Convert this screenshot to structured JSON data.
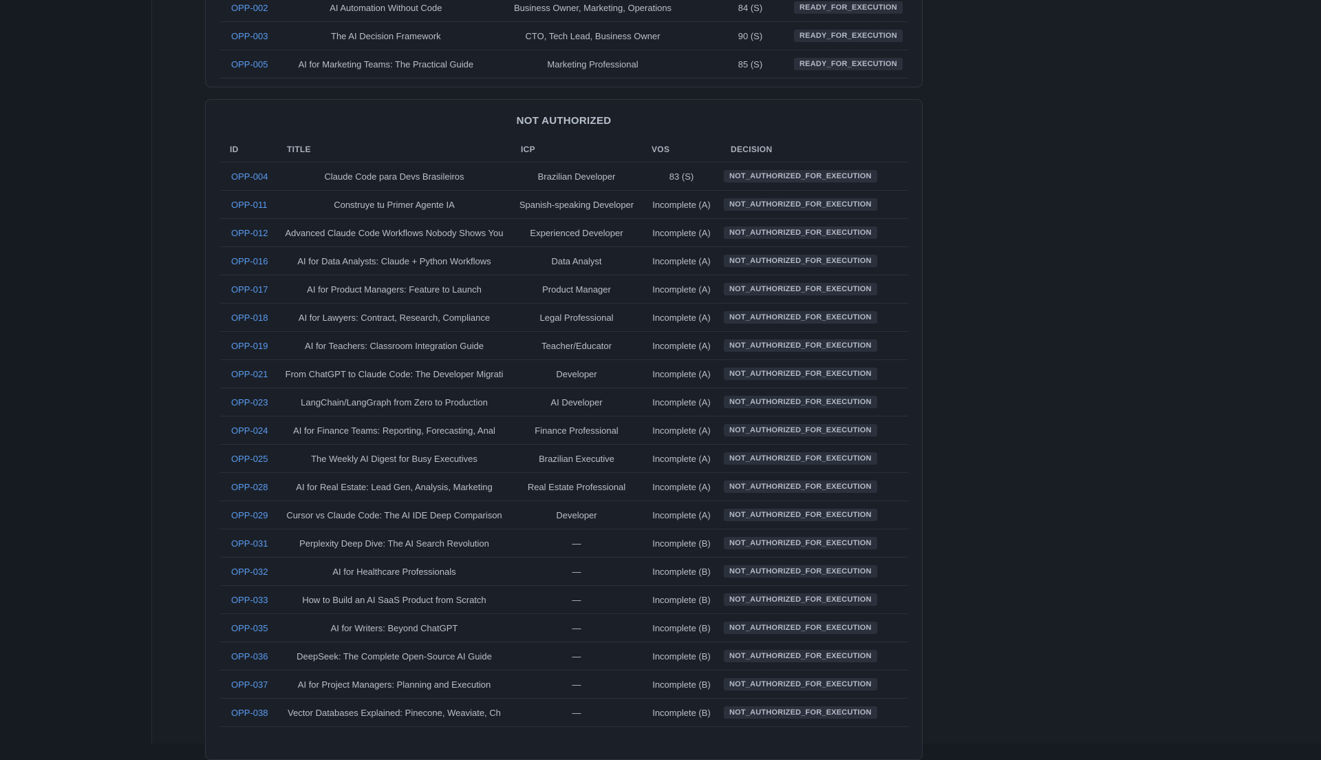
{
  "ready_table": {
    "rows": [
      {
        "id": "OPP-002",
        "title": "AI Automation Without Code",
        "icp": "Business Owner, Marketing, Operations",
        "vos": "84 (S)",
        "decision": "READY_FOR_EXECUTION"
      },
      {
        "id": "OPP-003",
        "title": "The AI Decision Framework",
        "icp": "CTO, Tech Lead, Business Owner",
        "vos": "90 (S)",
        "decision": "READY_FOR_EXECUTION"
      },
      {
        "id": "OPP-005",
        "title": "AI for Marketing Teams: The Practical Guide",
        "icp": "Marketing Professional",
        "vos": "85 (S)",
        "decision": "READY_FOR_EXECUTION"
      }
    ]
  },
  "not_authorized": {
    "title": "NOT AUTHORIZED",
    "headers": {
      "id": "ID",
      "title": "TITLE",
      "icp": "ICP",
      "vos": "VOS",
      "decision": "DECISION"
    },
    "rows": [
      {
        "id": "OPP-004",
        "title": "Claude Code para Devs Brasileiros",
        "icp": "Brazilian Developer",
        "vos": "83 (S)",
        "decision": "NOT_AUTHORIZED_FOR_EXECUTION"
      },
      {
        "id": "OPP-011",
        "title": "Construye tu Primer Agente IA",
        "icp": "Spanish-speaking Developer",
        "vos": "Incomplete (A)",
        "decision": "NOT_AUTHORIZED_FOR_EXECUTION"
      },
      {
        "id": "OPP-012",
        "title": "Advanced Claude Code Workflows Nobody Shows You",
        "icp": "Experienced Developer",
        "vos": "Incomplete (A)",
        "decision": "NOT_AUTHORIZED_FOR_EXECUTION"
      },
      {
        "id": "OPP-016",
        "title": "AI for Data Analysts: Claude + Python Workflows",
        "icp": "Data Analyst",
        "vos": "Incomplete (A)",
        "decision": "NOT_AUTHORIZED_FOR_EXECUTION"
      },
      {
        "id": "OPP-017",
        "title": "AI for Product Managers: Feature to Launch",
        "icp": "Product Manager",
        "vos": "Incomplete (A)",
        "decision": "NOT_AUTHORIZED_FOR_EXECUTION"
      },
      {
        "id": "OPP-018",
        "title": "AI for Lawyers: Contract, Research, Compliance",
        "icp": "Legal Professional",
        "vos": "Incomplete (A)",
        "decision": "NOT_AUTHORIZED_FOR_EXECUTION"
      },
      {
        "id": "OPP-019",
        "title": "AI for Teachers: Classroom Integration Guide",
        "icp": "Teacher/Educator",
        "vos": "Incomplete (A)",
        "decision": "NOT_AUTHORIZED_FOR_EXECUTION"
      },
      {
        "id": "OPP-021",
        "title": "From ChatGPT to Claude Code: The Developer Migrati",
        "icp": "Developer",
        "vos": "Incomplete (A)",
        "decision": "NOT_AUTHORIZED_FOR_EXECUTION"
      },
      {
        "id": "OPP-023",
        "title": "LangChain/LangGraph from Zero to Production",
        "icp": "AI Developer",
        "vos": "Incomplete (A)",
        "decision": "NOT_AUTHORIZED_FOR_EXECUTION"
      },
      {
        "id": "OPP-024",
        "title": "AI for Finance Teams: Reporting, Forecasting, Anal",
        "icp": "Finance Professional",
        "vos": "Incomplete (A)",
        "decision": "NOT_AUTHORIZED_FOR_EXECUTION"
      },
      {
        "id": "OPP-025",
        "title": "The Weekly AI Digest for Busy Executives",
        "icp": "Brazilian Executive",
        "vos": "Incomplete (A)",
        "decision": "NOT_AUTHORIZED_FOR_EXECUTION"
      },
      {
        "id": "OPP-028",
        "title": "AI for Real Estate: Lead Gen, Analysis, Marketing",
        "icp": "Real Estate Professional",
        "vos": "Incomplete (A)",
        "decision": "NOT_AUTHORIZED_FOR_EXECUTION"
      },
      {
        "id": "OPP-029",
        "title": "Cursor vs Claude Code: The AI IDE Deep Comparison",
        "icp": "Developer",
        "vos": "Incomplete (A)",
        "decision": "NOT_AUTHORIZED_FOR_EXECUTION"
      },
      {
        "id": "OPP-031",
        "title": "Perplexity Deep Dive: The AI Search Revolution",
        "icp": "—",
        "vos": "Incomplete (B)",
        "decision": "NOT_AUTHORIZED_FOR_EXECUTION"
      },
      {
        "id": "OPP-032",
        "title": "AI for Healthcare Professionals",
        "icp": "—",
        "vos": "Incomplete (B)",
        "decision": "NOT_AUTHORIZED_FOR_EXECUTION"
      },
      {
        "id": "OPP-033",
        "title": "How to Build an AI SaaS Product from Scratch",
        "icp": "—",
        "vos": "Incomplete (B)",
        "decision": "NOT_AUTHORIZED_FOR_EXECUTION"
      },
      {
        "id": "OPP-035",
        "title": "AI for Writers: Beyond ChatGPT",
        "icp": "—",
        "vos": "Incomplete (B)",
        "decision": "NOT_AUTHORIZED_FOR_EXECUTION"
      },
      {
        "id": "OPP-036",
        "title": "DeepSeek: The Complete Open-Source AI Guide",
        "icp": "—",
        "vos": "Incomplete (B)",
        "decision": "NOT_AUTHORIZED_FOR_EXECUTION"
      },
      {
        "id": "OPP-037",
        "title": "AI for Project Managers: Planning and Execution",
        "icp": "—",
        "vos": "Incomplete (B)",
        "decision": "NOT_AUTHORIZED_FOR_EXECUTION"
      },
      {
        "id": "OPP-038",
        "title": "Vector Databases Explained: Pinecone, Weaviate, Ch",
        "icp": "—",
        "vos": "Incomplete (B)",
        "decision": "NOT_AUTHORIZED_FOR_EXECUTION"
      }
    ]
  }
}
